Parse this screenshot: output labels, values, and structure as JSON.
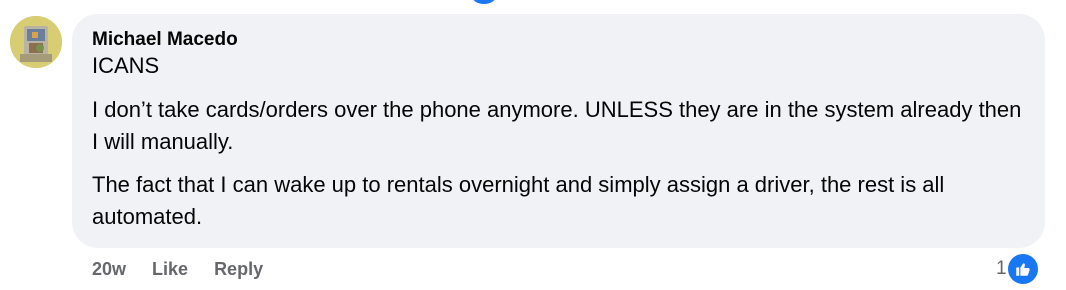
{
  "comment": {
    "author": "Michael Macedo",
    "org_line": "ICANS",
    "paragraphs": [
      "I don’t take cards/orders over the phone anymore. UNLESS they are in the system already then I will manually.",
      "The fact that I can wake up to rentals overnight and simply assign a driver, the rest is all automated."
    ],
    "timestamp": "20w",
    "like_label": "Like",
    "reply_label": "Reply",
    "reaction_count": "1",
    "reaction_icon": "thumbs-up-icon",
    "avatar_icon": "profile-photo"
  },
  "colors": {
    "bubble_bg": "#f0f2f5",
    "meta_text": "#65676b",
    "reaction_blue": "#1877f2",
    "text": "#050505"
  }
}
